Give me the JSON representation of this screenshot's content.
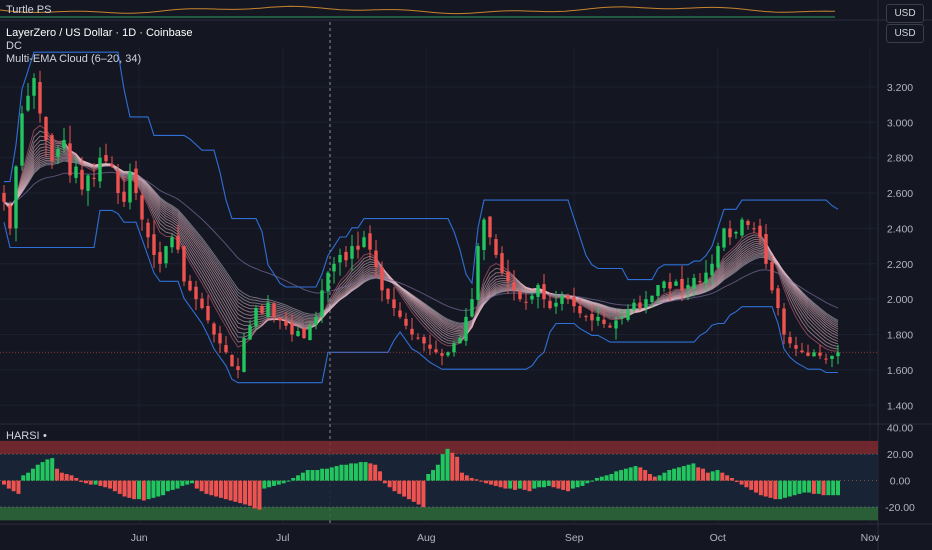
{
  "top_pane": {
    "label": "Turtle PS",
    "currency": "USD"
  },
  "main_pane": {
    "title": "LayerZero / US Dollar · 1D · Coinbase",
    "indicator1": "DC",
    "indicator2": "Multi-EMA Cloud (6–20, 34)",
    "currency": "USD"
  },
  "osc_pane": {
    "label": "HARSI",
    "dot": "•"
  },
  "colors": {
    "background": "#141722",
    "up": "#26a69a",
    "up_bright": "#22c55e",
    "down": "#ef5350",
    "channel": "#2f6fd6",
    "cloud": "#e9b8c3",
    "osc_zone_top": "#7f2a30",
    "osc_zone_bottom": "#2d6b3a",
    "osc_mid": "#182638",
    "turtle_orange": "#c8842e",
    "turtle_green": "#2e9b60"
  },
  "chart_data": [
    {
      "type": "candlestick",
      "title": "LayerZero / US Dollar · 1D · Coinbase",
      "y_axis": {
        "ticks": [
          "3.200",
          "3.000",
          "2.800",
          "2.600",
          "2.400",
          "2.200",
          "2.000",
          "1.800",
          "1.600",
          "1.400"
        ],
        "ylim": [
          1.3,
          3.42
        ]
      },
      "x_axis": {
        "ticks": [
          "Jun",
          "Jul",
          "Aug",
          "Sep",
          "Oct",
          "Nov"
        ]
      },
      "days": 175,
      "close_series_approx": [
        2.55,
        2.4,
        2.75,
        3.05,
        3.15,
        3.25,
        3.05,
        2.9,
        2.78,
        2.85,
        2.9,
        2.7,
        2.75,
        2.62,
        2.7,
        2.68,
        2.8,
        2.78,
        2.75,
        2.6,
        2.55,
        2.72,
        2.6,
        2.45,
        2.35,
        2.25,
        2.2,
        2.3,
        2.35,
        2.28,
        2.1,
        2.05,
        2.0,
        1.95,
        1.88,
        1.8,
        1.75,
        1.7,
        1.62,
        1.6,
        1.78,
        1.85,
        1.95,
        1.92,
        1.98,
        1.9,
        1.88,
        1.85,
        1.8,
        1.82,
        1.78,
        1.85,
        1.9,
        2.05,
        2.15,
        2.2,
        2.25,
        2.22,
        2.3,
        2.28,
        2.35,
        2.28,
        2.18,
        2.05,
        2.0,
        1.95,
        1.9,
        1.85,
        1.8,
        1.78,
        1.75,
        1.72,
        1.7,
        1.68,
        1.7,
        1.75,
        1.78,
        1.9,
        2.0,
        2.3,
        2.45,
        2.35,
        2.25,
        2.15,
        2.1,
        2.05,
        2.0,
        1.98,
        2.02,
        2.08,
        2.0,
        1.95,
        1.98,
        2.02,
        2.0,
        1.96,
        1.92,
        1.9,
        1.88,
        1.9,
        1.86,
        1.84,
        1.88,
        1.9,
        1.94,
        1.98,
        1.95,
        2.0,
        2.02,
        2.08,
        2.1,
        2.06,
        2.1,
        2.05,
        2.08,
        2.12,
        2.1,
        2.15,
        2.2,
        2.3,
        2.4,
        2.35,
        2.38,
        2.45,
        2.42,
        2.4,
        2.35,
        2.2,
        2.05,
        1.95,
        1.8,
        1.75,
        1.72,
        1.7,
        1.68,
        1.7,
        1.68,
        1.66,
        1.68,
        1.7
      ],
      "donchian_upper_approx": [
        3.3,
        2.6,
        2.2,
        2.55,
        1.9
      ],
      "donchian_lower_approx": [
        2.3,
        1.5,
        1.6,
        1.75,
        1.4,
        1.6
      ]
    },
    {
      "type": "bar",
      "title": "HARSI",
      "y_axis": {
        "ticks": [
          "40.00",
          "20.00",
          "0.00",
          "-20.00"
        ],
        "ylim": [
          -32,
          42
        ]
      },
      "zones": [
        {
          "from": 20,
          "to": 30,
          "name": "overbought"
        },
        {
          "from": -30,
          "to": -20,
          "name": "oversold"
        }
      ],
      "values_approx": [
        -3,
        -6,
        -8,
        -10,
        4,
        6,
        9,
        12,
        14,
        16,
        17,
        9,
        6,
        5,
        4,
        2,
        -1,
        -2,
        -3,
        -3,
        -4,
        -5,
        -6,
        -8,
        -10,
        -12,
        -13,
        -14,
        -14,
        -15,
        -14,
        -13,
        -12,
        -11,
        -8,
        -7,
        -6,
        -4,
        -3,
        -2,
        -6,
        -8,
        -10,
        -11,
        -12,
        -13,
        -14,
        -15,
        -16,
        -17,
        -18,
        -19,
        -21,
        -22,
        -6,
        -5,
        -4,
        -3,
        -2,
        0,
        2,
        4,
        6,
        8,
        8,
        8,
        9,
        9,
        10,
        11,
        12,
        12,
        13,
        13,
        14,
        14,
        13,
        12,
        7,
        -2,
        -5,
        -8,
        -10,
        -12,
        -14,
        -16,
        -18,
        -20,
        5,
        8,
        12,
        20,
        24,
        21,
        18,
        6,
        4,
        2,
        1,
        0,
        -2,
        -3,
        -4,
        -5,
        -6,
        -6,
        -7,
        -6,
        -7,
        -8,
        -6,
        -5,
        -5,
        -4,
        -5,
        -6,
        -7,
        -8,
        -6,
        -5,
        -4,
        -2,
        0,
        2,
        3,
        4,
        5,
        7,
        8,
        9,
        10,
        11,
        10,
        8,
        5,
        3,
        4,
        6,
        8,
        9,
        10,
        11,
        12,
        13,
        10,
        9,
        6,
        7,
        8,
        6,
        4,
        2,
        -1,
        -3,
        -5,
        -7,
        -9,
        -11,
        -12,
        -13,
        -14,
        -14,
        -13,
        -12,
        -11,
        -10,
        -9,
        -9,
        -10,
        -10,
        -11,
        -11,
        -11,
        -11
      ]
    },
    {
      "type": "line",
      "title": "Turtle PS",
      "series": [
        {
          "name": "orange"
        },
        {
          "name": "green"
        }
      ]
    }
  ]
}
